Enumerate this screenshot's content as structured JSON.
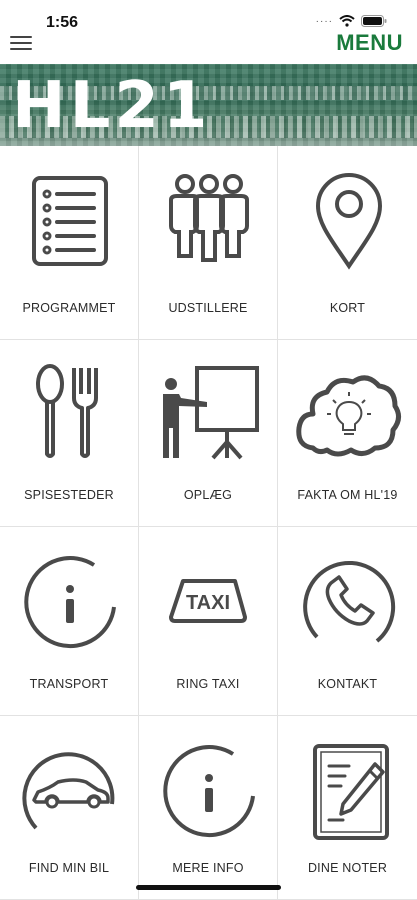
{
  "status_bar": {
    "time": "1:56"
  },
  "header": {
    "menu_label": "MENU"
  },
  "banner": {
    "title": "HL21"
  },
  "tiles": [
    {
      "label": "PROGRAMMET",
      "icon": "list-icon"
    },
    {
      "label": "UDSTILLERE",
      "icon": "people-icon"
    },
    {
      "label": "KORT",
      "icon": "map-pin-icon"
    },
    {
      "label": "SPISESTEDER",
      "icon": "spoon-fork-icon"
    },
    {
      "label": "OPLÆG",
      "icon": "presentation-icon"
    },
    {
      "label": "FAKTA OM HL'19",
      "icon": "cloud-lightbulb-icon"
    },
    {
      "label": "TRANSPORT",
      "icon": "info-icon"
    },
    {
      "label": "RING TAXI",
      "icon": "taxi-icon",
      "sign_text": "TAXI"
    },
    {
      "label": "KONTAKT",
      "icon": "phone-icon"
    },
    {
      "label": "FIND MIN BIL",
      "icon": "car-icon"
    },
    {
      "label": "MERE INFO",
      "icon": "info-icon"
    },
    {
      "label": "DINE NOTER",
      "icon": "notes-icon"
    }
  ],
  "colors": {
    "accent": "#1a7a3c",
    "icon_stroke": "#4a4a4a",
    "divider": "#e2e2e2"
  }
}
